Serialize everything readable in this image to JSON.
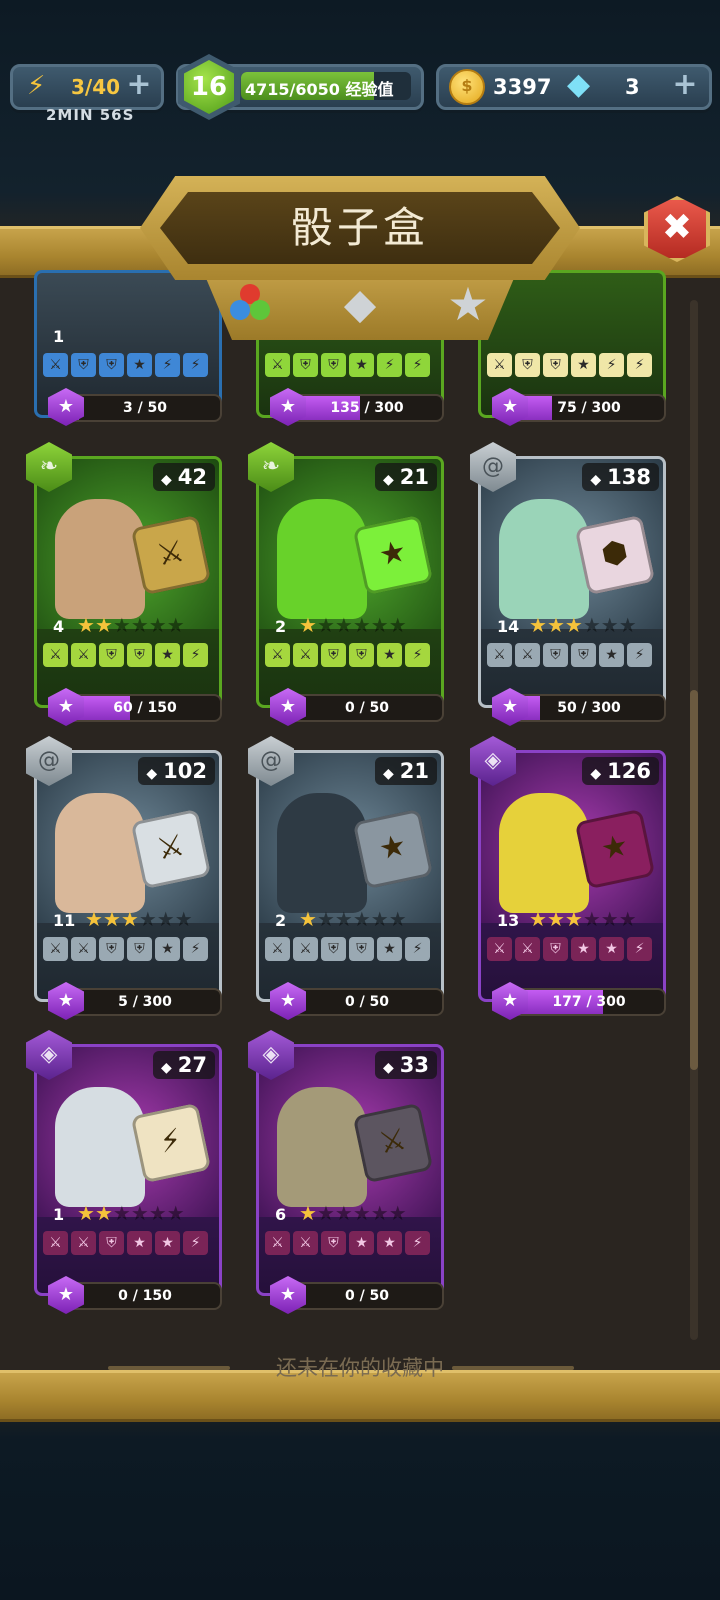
{
  "hud": {
    "energy": "3/40",
    "energy_timer": "2MIN 56S",
    "level": "16",
    "xp": "4715/6050 经验值",
    "xp_fraction": 0.78,
    "coins": "3397",
    "gems": "3"
  },
  "title": "骰子盒",
  "footer": "还未在你的收藏中",
  "top_row": [
    {
      "level": "1",
      "progress": "3 / 50",
      "fill": 0.06
    },
    {
      "level": "",
      "progress": "135 / 300",
      "fill": 0.45
    },
    {
      "level": "",
      "progress": "75 / 300",
      "fill": 0.25
    }
  ],
  "cards": [
    {
      "rarity": "common",
      "gems": "42",
      "level": "4",
      "stars": 2,
      "progress": "60 / 150",
      "fill": 0.4,
      "hero": "#c9a27a",
      "die": "#c9a64a",
      "die_glyph": "⚔"
    },
    {
      "rarity": "common",
      "gems": "21",
      "level": "2",
      "stars": 1,
      "progress": "0 / 50",
      "fill": 0,
      "hero": "#68d22a",
      "die": "#7cf03a",
      "die_glyph": "★"
    },
    {
      "rarity": "rare",
      "gems": "138",
      "level": "14",
      "stars": 3,
      "progress": "50 / 300",
      "fill": 0.17,
      "hero": "#9ad4b8",
      "die": "#e9d6df",
      "die_glyph": "⬢"
    },
    {
      "rarity": "rare",
      "gems": "102",
      "level": "11",
      "stars": 3,
      "progress": "5 / 300",
      "fill": 0.02,
      "hero": "#d9b89a",
      "die": "#d9dfe3",
      "die_glyph": "⚔"
    },
    {
      "rarity": "rare",
      "gems": "21",
      "level": "2",
      "stars": 1,
      "progress": "0 / 50",
      "fill": 0,
      "hero": "#2e3a44",
      "die": "#8a96a0",
      "die_glyph": "★"
    },
    {
      "rarity": "epic",
      "gems": "126",
      "level": "13",
      "stars": 3,
      "progress": "177 / 300",
      "fill": 0.59,
      "hero": "#e6d13a",
      "die": "#8a1f5f",
      "die_glyph": "★"
    },
    {
      "rarity": "epic",
      "gems": "27",
      "level": "1",
      "stars": 2,
      "progress": "0 / 150",
      "fill": 0,
      "hero": "#d6dde2",
      "die": "#efe3c2",
      "die_glyph": "⚡"
    },
    {
      "rarity": "epic",
      "gems": "33",
      "level": "6",
      "stars": 1,
      "progress": "0 / 50",
      "fill": 0,
      "hero": "#a49a78",
      "die": "#5c5560",
      "die_glyph": "⚔"
    }
  ]
}
